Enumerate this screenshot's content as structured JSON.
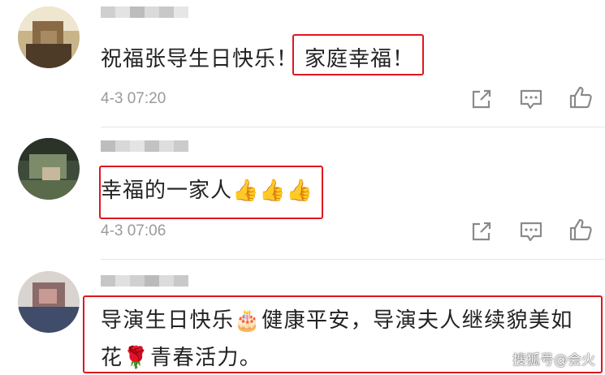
{
  "comments": [
    {
      "text_before": "祝福张导生日快乐！",
      "text_highlight": "家庭幸福！",
      "timestamp": "4-3 07:20",
      "actions": {
        "share_icon": "share-icon",
        "reply_icon": "comment-icon",
        "like_icon": "thumbs-up-icon"
      }
    },
    {
      "text_highlight": "幸福的一家人👍👍👍",
      "timestamp": "4-3 07:06",
      "actions": {
        "share_icon": "share-icon",
        "reply_icon": "comment-icon",
        "like_icon": "thumbs-up-icon"
      }
    },
    {
      "line1": "导演生日快乐🎂健康平安，导演夫人继续貌美如",
      "line2": "花🌹青春活力。"
    }
  ],
  "watermark": "搜狐号@会火",
  "colors": {
    "highlight": "#e0161e",
    "meta": "#9a9a9a",
    "text": "#222222"
  }
}
